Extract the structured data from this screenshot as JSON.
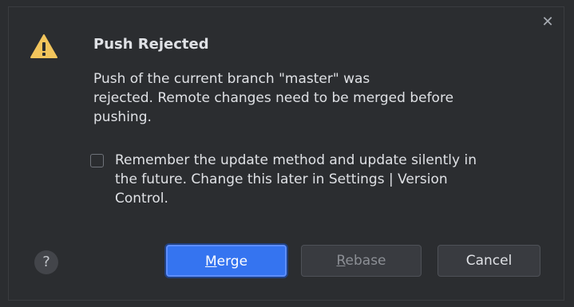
{
  "dialog": {
    "close_icon": "close-icon",
    "warning_icon": "warning-triangle-icon",
    "title": "Push Rejected",
    "message_lines": [
      "Push of the current branch \"master\" was",
      "rejected. Remote changes need to be merged before",
      "pushing."
    ],
    "checkbox": {
      "checked": false,
      "label_lines": [
        "Remember the update method and update silently in",
        "the future. Change this later in Settings | Version",
        "Control."
      ]
    },
    "help_label": "?",
    "buttons": {
      "merge": {
        "mnemonic": "M",
        "rest": "erge",
        "label": "Merge"
      },
      "rebase": {
        "mnemonic": "R",
        "rest": "ebase",
        "label": "Rebase"
      },
      "cancel": {
        "label": "Cancel"
      }
    }
  },
  "colors": {
    "background": "#2b2d30",
    "text": "#dfe1e5",
    "accent": "#3574f0",
    "warning": "#f2c55c"
  }
}
